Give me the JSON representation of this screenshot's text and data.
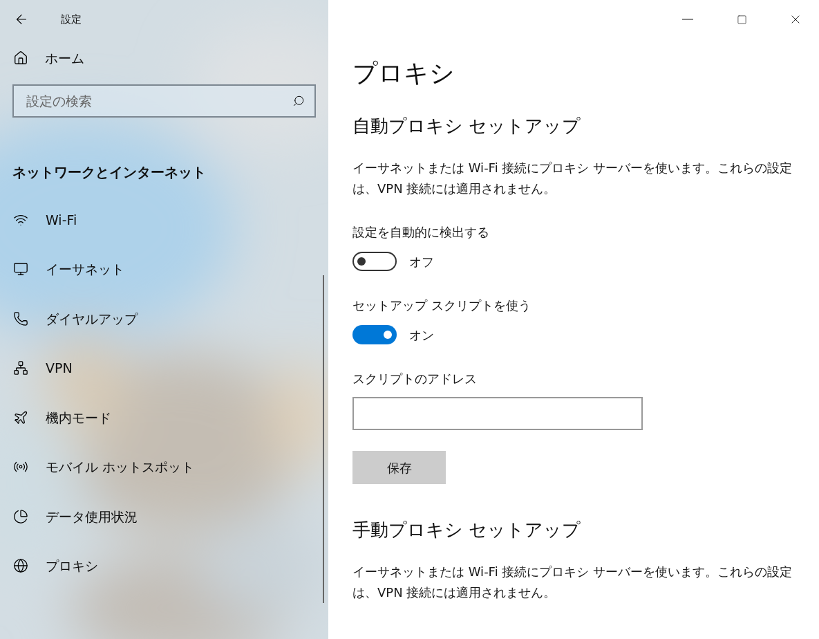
{
  "window": {
    "title": "設定"
  },
  "sidebar": {
    "home": "ホーム",
    "search": {
      "placeholder": "設定の検索"
    },
    "section": "ネットワークとインターネット",
    "items": [
      {
        "label": "Wi-Fi"
      },
      {
        "label": "イーサネット"
      },
      {
        "label": "ダイヤルアップ"
      },
      {
        "label": "VPN"
      },
      {
        "label": "機内モード"
      },
      {
        "label": "モバイル ホットスポット"
      },
      {
        "label": "データ使用状況"
      },
      {
        "label": "プロキシ"
      }
    ]
  },
  "page": {
    "title": "プロキシ",
    "sections": [
      {
        "heading": "自動プロキシ セットアップ",
        "description": "イーサネットまたは Wi-Fi 接続にプロキシ サーバーを使います。これらの設定は、VPN 接続には適用されません。",
        "settings": [
          {
            "kind": "toggle",
            "label": "設定を自動的に検出する",
            "on": false,
            "state_text": "オフ"
          },
          {
            "kind": "toggle",
            "label": "セットアップ スクリプトを使う",
            "on": true,
            "state_text": "オン"
          },
          {
            "kind": "field",
            "label": "スクリプトのアドレス"
          },
          {
            "kind": "button",
            "label": "保存"
          }
        ]
      },
      {
        "heading": "手動プロキシ セットアップ",
        "description": "イーサネットまたは Wi-Fi 接続にプロキシ サーバーを使います。これらの設定は、VPN 接続には適用されません。"
      }
    ]
  }
}
